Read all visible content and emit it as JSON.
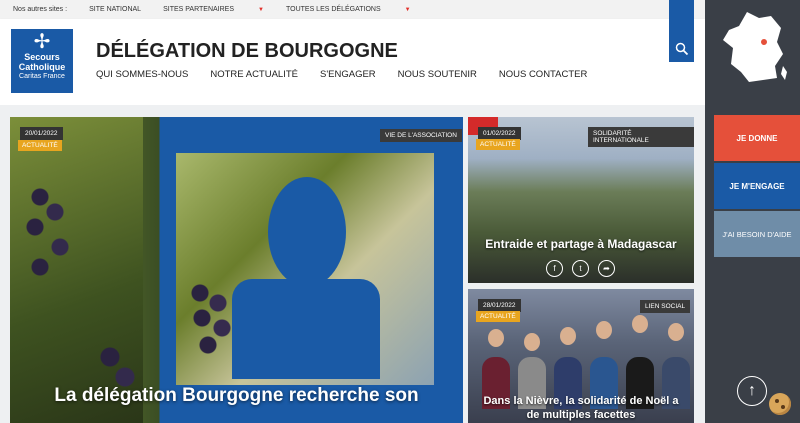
{
  "topbar": {
    "label": "Nos autres sites :",
    "site_national": "SITE NATIONAL",
    "sites_partenaires": "SITES PARTENAIRES",
    "toutes_delegations": "TOUTES LES DÉLÉGATIONS"
  },
  "logo": {
    "line1": "Secours",
    "line2": "Catholique",
    "line3": "Caritas France"
  },
  "header": {
    "title": "DÉLÉGATION DE BOURGOGNE",
    "nav": [
      "QUI SOMMES-NOUS",
      "NOTRE ACTUALITÉ",
      "S'ENGAGER",
      "NOUS SOUTENIR",
      "NOUS CONTACTER"
    ]
  },
  "cta": {
    "donate": "JE DONNE",
    "engage": "JE M'ENGAGE",
    "help": "J'AI BESOIN D'AIDE"
  },
  "feature": {
    "date": "20/01/2022",
    "category": "ACTUALITÉ",
    "tag": "VIE DE L'ASSOCIATION",
    "title": "La délégation Bourgogne recherche son"
  },
  "card1": {
    "date": "01/02/2022",
    "category": "ACTUALITÉ",
    "tag": "SOLIDARITÉ INTERNATIONALE",
    "title": "Entraide et partage à Madagascar"
  },
  "card2": {
    "date": "28/01/2022",
    "category": "ACTUALITÉ",
    "tag": "LIEN SOCIAL",
    "title_line1": "Dans la Nièvre, la solidarité de Noël a",
    "title_line2": "de multiples facettes"
  },
  "icons": {
    "search": "search-icon",
    "facebook": "facebook-icon",
    "twitter": "twitter-icon",
    "share": "share-icon",
    "scroll_top": "arrow-up-icon",
    "cookie": "cookie-icon"
  },
  "colors": {
    "brand_blue": "#1a5aa6",
    "donate_orange": "#e5503a",
    "category_yellow": "#e8a51f",
    "help_blue": "#6f8da8"
  }
}
